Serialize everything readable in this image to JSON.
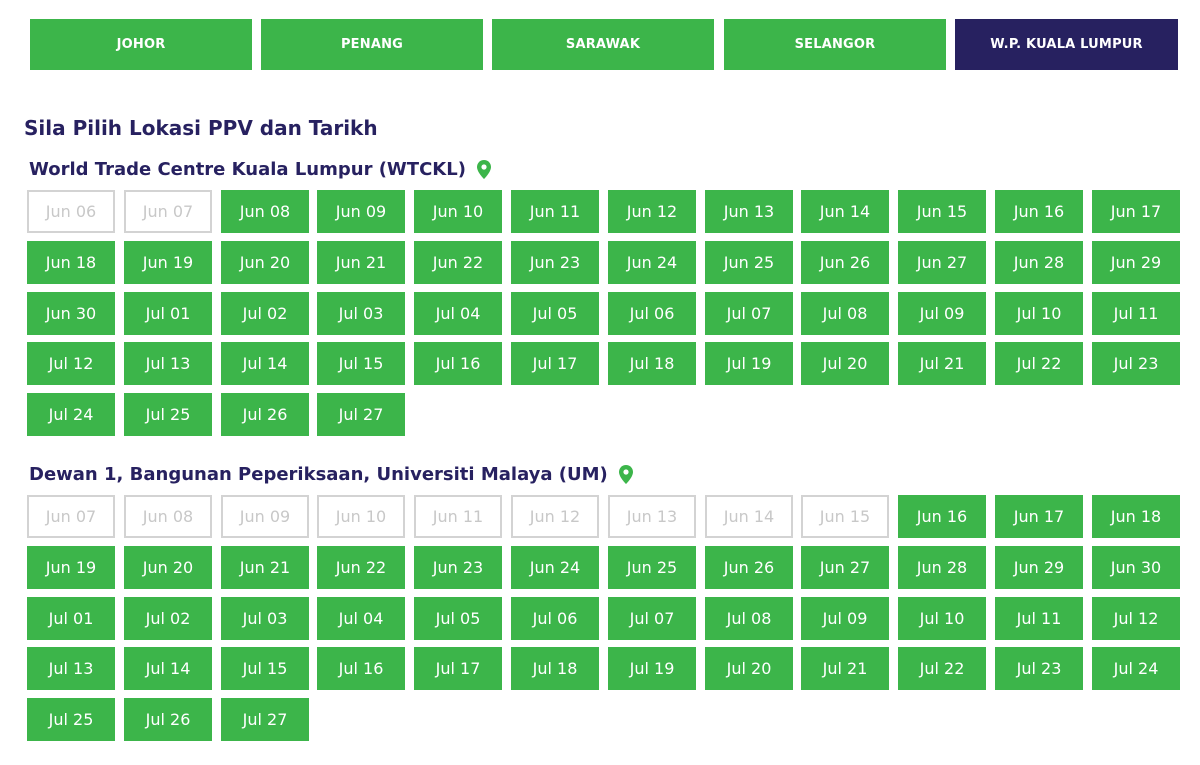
{
  "tabs": [
    {
      "label": "JOHOR",
      "active": false
    },
    {
      "label": "PENANG",
      "active": false
    },
    {
      "label": "SARAWAK",
      "active": false
    },
    {
      "label": "SELANGOR",
      "active": false
    },
    {
      "label": "W.P. KUALA LUMPUR",
      "active": true
    }
  ],
  "heading": "Sila Pilih Lokasi PPV dan Tarikh",
  "colors": {
    "green": "#3cb54a",
    "navy": "#272160",
    "disabled_border": "#d3d3d3",
    "disabled_text": "#c8c8c8"
  },
  "locations": [
    {
      "name": "World Trade Centre Kuala Lumpur (WTCKL)",
      "icon": "map-pin-icon",
      "dates": [
        {
          "label": "Jun 06",
          "available": false
        },
        {
          "label": "Jun 07",
          "available": false
        },
        {
          "label": "Jun 08",
          "available": true
        },
        {
          "label": "Jun 09",
          "available": true
        },
        {
          "label": "Jun 10",
          "available": true
        },
        {
          "label": "Jun 11",
          "available": true
        },
        {
          "label": "Jun 12",
          "available": true
        },
        {
          "label": "Jun 13",
          "available": true
        },
        {
          "label": "Jun 14",
          "available": true
        },
        {
          "label": "Jun 15",
          "available": true
        },
        {
          "label": "Jun 16",
          "available": true
        },
        {
          "label": "Jun 17",
          "available": true
        },
        {
          "label": "Jun 18",
          "available": true
        },
        {
          "label": "Jun 19",
          "available": true
        },
        {
          "label": "Jun 20",
          "available": true
        },
        {
          "label": "Jun 21",
          "available": true
        },
        {
          "label": "Jun 22",
          "available": true
        },
        {
          "label": "Jun 23",
          "available": true
        },
        {
          "label": "Jun 24",
          "available": true
        },
        {
          "label": "Jun 25",
          "available": true
        },
        {
          "label": "Jun 26",
          "available": true
        },
        {
          "label": "Jun 27",
          "available": true
        },
        {
          "label": "Jun 28",
          "available": true
        },
        {
          "label": "Jun 29",
          "available": true
        },
        {
          "label": "Jun 30",
          "available": true
        },
        {
          "label": "Jul 01",
          "available": true
        },
        {
          "label": "Jul 02",
          "available": true
        },
        {
          "label": "Jul 03",
          "available": true
        },
        {
          "label": "Jul 04",
          "available": true
        },
        {
          "label": "Jul 05",
          "available": true
        },
        {
          "label": "Jul 06",
          "available": true
        },
        {
          "label": "Jul 07",
          "available": true
        },
        {
          "label": "Jul 08",
          "available": true
        },
        {
          "label": "Jul 09",
          "available": true
        },
        {
          "label": "Jul 10",
          "available": true
        },
        {
          "label": "Jul 11",
          "available": true
        },
        {
          "label": "Jul 12",
          "available": true
        },
        {
          "label": "Jul 13",
          "available": true
        },
        {
          "label": "Jul 14",
          "available": true
        },
        {
          "label": "Jul 15",
          "available": true
        },
        {
          "label": "Jul 16",
          "available": true
        },
        {
          "label": "Jul 17",
          "available": true
        },
        {
          "label": "Jul 18",
          "available": true
        },
        {
          "label": "Jul 19",
          "available": true
        },
        {
          "label": "Jul 20",
          "available": true
        },
        {
          "label": "Jul 21",
          "available": true
        },
        {
          "label": "Jul 22",
          "available": true
        },
        {
          "label": "Jul 23",
          "available": true
        },
        {
          "label": "Jul 24",
          "available": true
        },
        {
          "label": "Jul 25",
          "available": true
        },
        {
          "label": "Jul 26",
          "available": true
        },
        {
          "label": "Jul 27",
          "available": true
        }
      ]
    },
    {
      "name": "Dewan 1, Bangunan Peperiksaan, Universiti Malaya (UM)",
      "icon": "map-pin-icon",
      "dates": [
        {
          "label": "Jun 07",
          "available": false
        },
        {
          "label": "Jun 08",
          "available": false
        },
        {
          "label": "Jun 09",
          "available": false
        },
        {
          "label": "Jun 10",
          "available": false
        },
        {
          "label": "Jun 11",
          "available": false
        },
        {
          "label": "Jun 12",
          "available": false
        },
        {
          "label": "Jun 13",
          "available": false
        },
        {
          "label": "Jun 14",
          "available": false
        },
        {
          "label": "Jun 15",
          "available": false
        },
        {
          "label": "Jun 16",
          "available": true
        },
        {
          "label": "Jun 17",
          "available": true
        },
        {
          "label": "Jun 18",
          "available": true
        },
        {
          "label": "Jun 19",
          "available": true
        },
        {
          "label": "Jun 20",
          "available": true
        },
        {
          "label": "Jun 21",
          "available": true
        },
        {
          "label": "Jun 22",
          "available": true
        },
        {
          "label": "Jun 23",
          "available": true
        },
        {
          "label": "Jun 24",
          "available": true
        },
        {
          "label": "Jun 25",
          "available": true
        },
        {
          "label": "Jun 26",
          "available": true
        },
        {
          "label": "Jun 27",
          "available": true
        },
        {
          "label": "Jun 28",
          "available": true
        },
        {
          "label": "Jun 29",
          "available": true
        },
        {
          "label": "Jun 30",
          "available": true
        },
        {
          "label": "Jul 01",
          "available": true
        },
        {
          "label": "Jul 02",
          "available": true
        },
        {
          "label": "Jul 03",
          "available": true
        },
        {
          "label": "Jul 04",
          "available": true
        },
        {
          "label": "Jul 05",
          "available": true
        },
        {
          "label": "Jul 06",
          "available": true
        },
        {
          "label": "Jul 07",
          "available": true
        },
        {
          "label": "Jul 08",
          "available": true
        },
        {
          "label": "Jul 09",
          "available": true
        },
        {
          "label": "Jul 10",
          "available": true
        },
        {
          "label": "Jul 11",
          "available": true
        },
        {
          "label": "Jul 12",
          "available": true
        },
        {
          "label": "Jul 13",
          "available": true
        },
        {
          "label": "Jul 14",
          "available": true
        },
        {
          "label": "Jul 15",
          "available": true
        },
        {
          "label": "Jul 16",
          "available": true
        },
        {
          "label": "Jul 17",
          "available": true
        },
        {
          "label": "Jul 18",
          "available": true
        },
        {
          "label": "Jul 19",
          "available": true
        },
        {
          "label": "Jul 20",
          "available": true
        },
        {
          "label": "Jul 21",
          "available": true
        },
        {
          "label": "Jul 22",
          "available": true
        },
        {
          "label": "Jul 23",
          "available": true
        },
        {
          "label": "Jul 24",
          "available": true
        },
        {
          "label": "Jul 25",
          "available": true
        },
        {
          "label": "Jul 26",
          "available": true
        },
        {
          "label": "Jul 27",
          "available": true
        }
      ]
    }
  ]
}
